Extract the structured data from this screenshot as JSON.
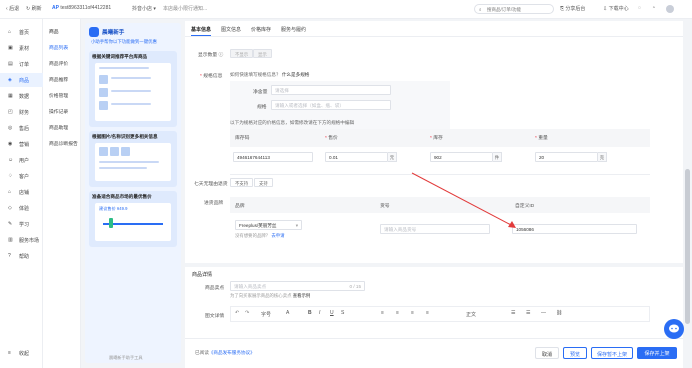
{
  "topbar": {
    "back": "后退",
    "refresh": "刷新",
    "account": "test8963311of4412281",
    "dropdown": "抖音小店",
    "store_link": "本店最小限行通知...",
    "search_placeholder": "搜商品/订单/功能",
    "shortcut": "分享后台",
    "download": "下载中心"
  },
  "sidebar": {
    "items": [
      {
        "label": "首页",
        "icon": "home-icon"
      },
      {
        "label": "素材",
        "icon": "image-icon"
      },
      {
        "label": "订单",
        "icon": "order-icon"
      },
      {
        "label": "商品",
        "icon": "product-icon"
      },
      {
        "label": "数据",
        "icon": "chart-icon"
      },
      {
        "label": "财务",
        "icon": "wallet-icon"
      },
      {
        "label": "售后",
        "icon": "service-icon"
      },
      {
        "label": "营销",
        "icon": "marketing-icon"
      },
      {
        "label": "用户",
        "icon": "user-icon"
      },
      {
        "label": "客户",
        "icon": "customer-icon"
      },
      {
        "label": "店铺",
        "icon": "store-icon"
      },
      {
        "label": "体验",
        "icon": "experience-icon"
      },
      {
        "label": "学习",
        "icon": "learn-icon"
      },
      {
        "label": "服务市场",
        "icon": "market-icon"
      },
      {
        "label": "帮助",
        "icon": "help-icon"
      }
    ],
    "collapse": "收起"
  },
  "subnav": {
    "items": [
      "商品",
      "商品列表",
      "商品评价",
      "商品推荐",
      "价格管理",
      "操作记录",
      "商品助理",
      "商品诊断报告"
    ],
    "active_index": 1
  },
  "guide": {
    "title": "晨曦新手",
    "subtitle": "小助手帮你以下功能做到一键优惠",
    "card1_title": "根据关键词推荐平台库商品",
    "card2_title": "根据图片/名称识别更多相关信息",
    "card3_title": "准备适合商品市场的最优售价",
    "card3_sub": "建议售价 ¥49.9",
    "footer": "晨曦新手助手工具"
  },
  "tabs": [
    "基本信息",
    "图文信息",
    "价格库存",
    "服务与履约"
  ],
  "form": {
    "price_count_label": "显示数量",
    "price_count_opts": [
      "不显示",
      "显示"
    ],
    "spec_label": "规格信息",
    "spec_tip": "如何快速填写规格信息？",
    "spec_link": "什么是多规格",
    "net_label": "净含量",
    "net_placeholder": "请选择",
    "pack_label": "规格",
    "pack_placeholder": "请输入或者选择（如盒、瓶、袋）",
    "table_tip": "以下为规格对应的价格信息，如需修改请在下方的规格中编辑",
    "cols": [
      "库存码",
      "售价",
      "库存",
      "重量"
    ],
    "row": {
      "code": "4946167644113",
      "price": "0.01",
      "price_unit": "元",
      "stock": "902",
      "stock_unit": "件",
      "weight": "20",
      "weight_unit": "克"
    },
    "seven_day_label": "七天无理由退货",
    "seven_day_opts": [
      "不支持",
      "支持"
    ],
    "brand_label": "进货品牌",
    "brand_cols": [
      "品牌",
      "货号",
      "自定义ID"
    ],
    "brand_value": "Freeplus/芙丽芳丝",
    "brand_tip": "没有想要的品牌？",
    "brand_link": "去申请",
    "sku_placeholder": "请输入商品货号",
    "custom_id": "1056086",
    "detail_section": "商品详情",
    "selling_label": "商品卖点",
    "selling_placeholder": "请输入商品卖点",
    "selling_count": "0 / 15",
    "selling_tip": "为了向买家展示商品的核心卖点",
    "selling_link": "查看示例",
    "rich_label": "图文详情",
    "toolbar": [
      "字号",
      "B",
      "I",
      "U",
      "正文"
    ]
  },
  "bottombar": {
    "agreement_prefix": "已阅读",
    "agreement_link": "《商品发布服务协议》",
    "cancel": "取消",
    "preview": "预览",
    "save_draft": "保存暂不上架",
    "save_publish": "保存并上架"
  },
  "colors": {
    "accent": "#2a6df4",
    "arrow": "#e23b3b"
  }
}
